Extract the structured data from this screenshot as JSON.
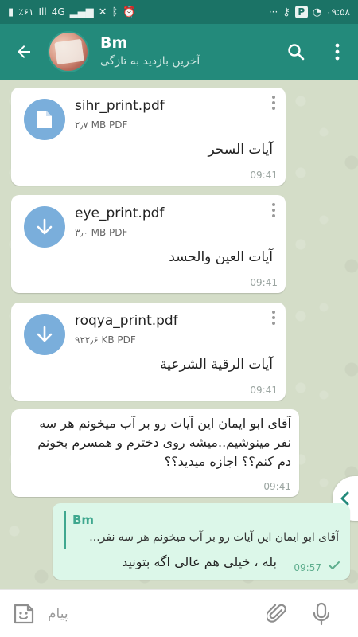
{
  "status_bar": {
    "battery": "٪۶۱",
    "network": "4G",
    "signal_label": "Ill",
    "right_icons_text": "···",
    "p_badge": "P",
    "clock": "۰۹:۵۸"
  },
  "header": {
    "chat_name": "Bm",
    "last_seen": "آخرین بازدید به تازگی"
  },
  "messages": [
    {
      "type": "file",
      "file_name": "sihr_print.pdf",
      "file_size": "۲٫۷ MB PDF",
      "caption": "آيات السحر",
      "time": "09:41",
      "icon": "document-icon"
    },
    {
      "type": "file",
      "file_name": "eye_print.pdf",
      "file_size": "۳٫۰ MB PDF",
      "caption": "آيات العين والحسد",
      "time": "09:41",
      "icon": "download-arrow-icon"
    },
    {
      "type": "file",
      "file_name": "roqya_print.pdf",
      "file_size": "۹۲۲٫۶ KB PDF",
      "caption": "آيات الرقية الشرعية",
      "time": "09:41",
      "icon": "download-arrow-icon"
    },
    {
      "type": "text",
      "text": "آقای ابو ایمان این آیات رو بر آب میخونم هر سه نفر مینوشیم..میشه روی دخترم و همسرم بخونم دم کنم؟؟ اجازه میدید؟؟",
      "time": "09:41"
    },
    {
      "type": "outgoing",
      "reply_to_name": "Bm",
      "reply_to_text": "آقای ابو ایمان این آیات رو بر آب میخونم هر سه نفر...",
      "text": "بله ، خیلی هم عالی اگه بتونید",
      "time": "09:57"
    }
  ],
  "composer": {
    "placeholder": "پیام"
  },
  "colors": {
    "header": "#238a7b",
    "status_bar": "#1b7366",
    "file_icon": "#7aaedb",
    "outgoing_bubble": "#dcf7e9",
    "reply_accent": "#3fa88f"
  }
}
